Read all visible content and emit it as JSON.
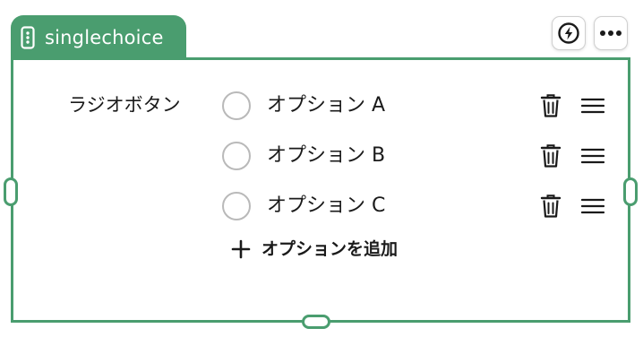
{
  "field": {
    "type_tag": "singlechoice",
    "type_icon": "field-type-icon",
    "label": "ラジオボタン"
  },
  "toolbar": {
    "action_icon": "bolt-icon",
    "more_icon": "more-icon"
  },
  "options": [
    {
      "label": "オプション A",
      "selected": false
    },
    {
      "label": "オプション B",
      "selected": false
    },
    {
      "label": "オプション C",
      "selected": false
    }
  ],
  "add_option": {
    "label": "オプションを追加",
    "icon": "plus-icon"
  },
  "colors": {
    "accent": "#4a9d6f",
    "text": "#1a1a1a",
    "radio_border": "#b9b9b9"
  }
}
